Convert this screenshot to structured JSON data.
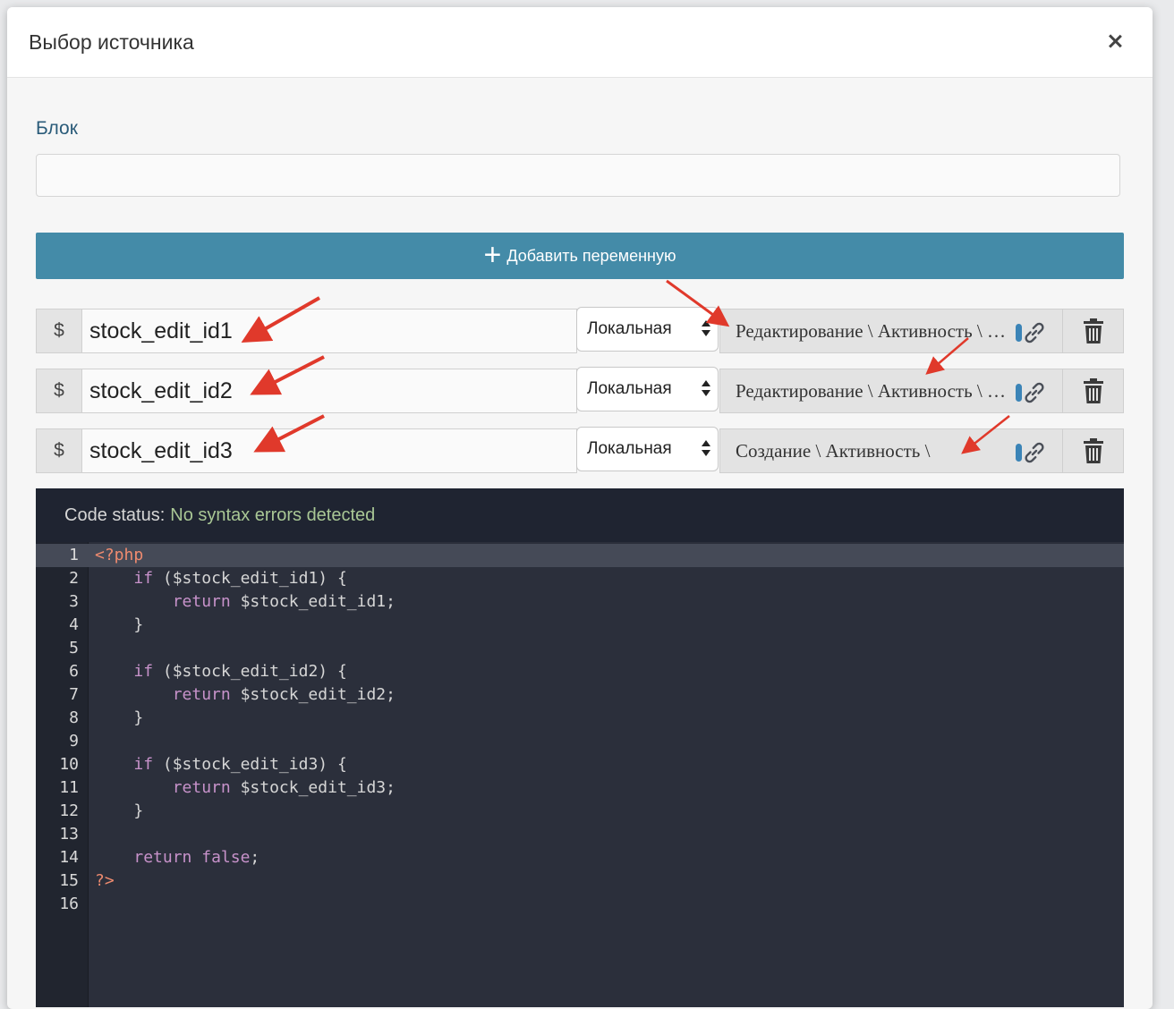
{
  "dialog": {
    "title": "Выбор источника",
    "close_icon": "close-icon"
  },
  "block": {
    "label": "Блок",
    "value": ""
  },
  "add_variable": {
    "label": "Добавить переменную",
    "icon": "plus-icon"
  },
  "variables": [
    {
      "prefix": "$",
      "name": "stock_edit_id1",
      "scope": "Локальная",
      "source": "Редактирование \\ Активность \\ Редактирование"
    },
    {
      "prefix": "$",
      "name": "stock_edit_id2",
      "scope": "Локальная",
      "source": "Редактирование \\ Активность \\ Редактирование"
    },
    {
      "prefix": "$",
      "name": "stock_edit_id3",
      "scope": "Локальная",
      "source": "Создание \\ Активность \\"
    }
  ],
  "code": {
    "status_label": "Code status:",
    "status_value": "No syntax errors detected",
    "active_line": 1,
    "lines": [
      "<?php",
      "    if ($stock_edit_id1) {",
      "        return $stock_edit_id1;",
      "    }",
      "",
      "    if ($stock_edit_id2) {",
      "        return $stock_edit_id2;",
      "    }",
      "",
      "    if ($stock_edit_id3) {",
      "        return $stock_edit_id3;",
      "    }",
      "",
      "    return false;",
      "?>",
      ""
    ]
  },
  "colors": {
    "primary_button": "#448ba8",
    "code_bg": "#2b2f3b",
    "status_ok": "#a9c795",
    "annotation_arrow": "#e0392b"
  }
}
